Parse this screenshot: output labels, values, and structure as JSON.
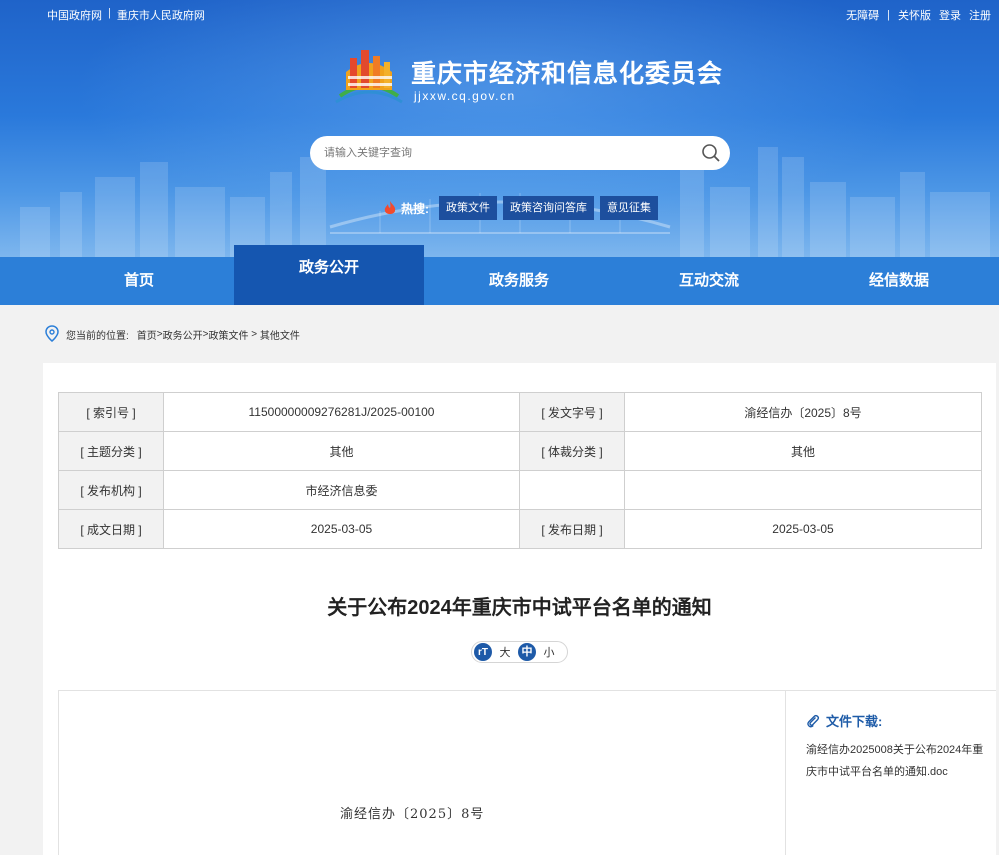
{
  "top_left_links": [
    "中国政府网",
    "重庆市人民政府网"
  ],
  "top_right_links": [
    "无障碍",
    "关怀版",
    "登录",
    "注册"
  ],
  "site": {
    "title": "重庆市经济和信息化委员会",
    "url": "jjxxw.cq.gov.cn"
  },
  "search": {
    "placeholder": "请输入关键字查询"
  },
  "hot": {
    "label": "热搜:",
    "tags": [
      "政策文件",
      "政策咨询问答库",
      "意见征集"
    ]
  },
  "nav": {
    "items": [
      "首页",
      "政务公开",
      "政务服务",
      "互动交流",
      "经信数据"
    ],
    "active": "政务公开"
  },
  "breadcrumb": {
    "prefix": "您当前的位置:",
    "items": [
      "首页",
      "政务公开",
      "政策文件",
      "其他文件"
    ],
    "separators": [
      ">",
      ">",
      " > "
    ]
  },
  "meta": [
    [
      "[ 索引号 ]",
      "11500000009276281J/2025-00100",
      "[ 发文字号 ]",
      "渝经信办〔2025〕8号"
    ],
    [
      "[ 主题分类 ]",
      "其他",
      "[ 体裁分类 ]",
      "其他"
    ],
    [
      "[ 发布机构 ]",
      "市经济信息委",
      "",
      ""
    ],
    [
      "[ 成文日期 ]",
      "2025-03-05",
      "[ 发布日期 ]",
      "2025-03-05"
    ]
  ],
  "document": {
    "title": "关于公布2024年重庆市中试平台名单的通知",
    "doc_number": "渝经信办〔2025〕8号"
  },
  "font_size": {
    "icon": "rT",
    "options": [
      "大",
      "中",
      "小"
    ],
    "selected": "中"
  },
  "download": {
    "title": "文件下载:",
    "file": "渝经信办2025008关于公布2024年重庆市中试平台名单的通知.doc"
  },
  "colors": {
    "nav": "#2c7fd8",
    "nav_active": "#1556b0",
    "tag_bg": "#1d4f9e",
    "accent": "#1f5ca8"
  }
}
